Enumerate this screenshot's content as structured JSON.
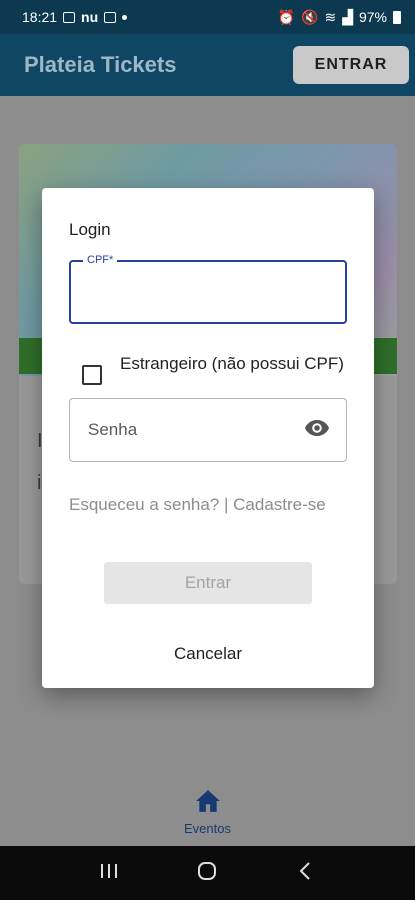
{
  "status_bar": {
    "time": "18:21",
    "carrier": "nu",
    "battery": "97%"
  },
  "app_bar": {
    "title": "Plateia Tickets",
    "login_button": "ENTRAR"
  },
  "background": {
    "card_text_1": "I",
    "card_text_2": "i"
  },
  "bottom_nav": {
    "items": [
      {
        "label": "Eventos",
        "icon": "home-icon"
      }
    ]
  },
  "dialog": {
    "title": "Login",
    "cpf_label": "CPF*",
    "cpf_value": "",
    "foreigner_checkbox": {
      "label": "Estrangeiro (não possui CPF)",
      "checked": false
    },
    "password_placeholder": "Senha",
    "forgot_link": "Esqueceu a senha? | Cadastre-se",
    "submit_button": "Entrar",
    "cancel_button": "Cancelar"
  },
  "colors": {
    "app_bar": "#0e4664",
    "accent": "#2b3f9e",
    "nav_active": "#173a72"
  }
}
